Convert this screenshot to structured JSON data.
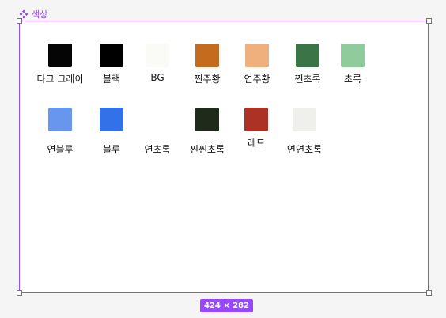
{
  "component": {
    "name": "색상",
    "icon": "component-icon"
  },
  "frame": {
    "size_label": "424 × 282"
  },
  "colors": {
    "accent": "#9747ff"
  },
  "swatches": [
    {
      "label": "다크 그레이",
      "color": "#050505"
    },
    {
      "label": "블랙",
      "color": "#000000"
    },
    {
      "label": "BG",
      "color": "#fafbf7"
    },
    {
      "label": "찐주황",
      "color": "#c46b1e"
    },
    {
      "label": "연주황",
      "color": "#f0b07e"
    },
    {
      "label": "찐초록",
      "color": "#3b7547"
    },
    {
      "label": "초록",
      "color": "#8fcb9b"
    },
    {
      "label": "연블루",
      "color": "#6896ee"
    },
    {
      "label": "블루",
      "color": "#3271e8"
    },
    {
      "label": "연초록",
      "color": "#ffffff"
    },
    {
      "label": "찐찐초록",
      "color": "#1f2a1b"
    },
    {
      "label": "레드",
      "color": "#ad3226"
    },
    {
      "label": "연연초록",
      "color": "#eff0ec"
    }
  ]
}
